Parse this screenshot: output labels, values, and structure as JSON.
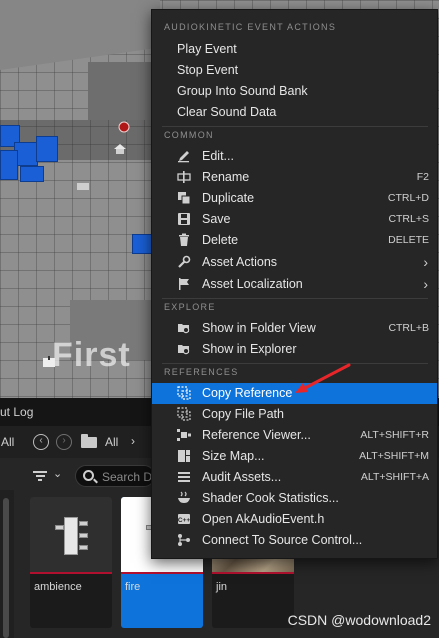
{
  "viewport": {
    "overlay_text": "First"
  },
  "content_browser": {
    "tab_label": "ut Log",
    "toolbar": {
      "all_label_1": "All",
      "back_icon": "arrow-left-circle-icon",
      "forward_icon": "arrow-right-circle-icon",
      "folder_icon": "folder-icon",
      "all_label_2": "All",
      "chevron": "›"
    },
    "filter": {
      "filter_icon": "filter-icon",
      "search_placeholder": "Search D"
    },
    "assets": [
      {
        "name": "ambience",
        "selected": false
      },
      {
        "name": "fire",
        "selected": true
      },
      {
        "name": "jin",
        "selected": false
      }
    ]
  },
  "context_menu": {
    "sections": {
      "audiokinetic": "AUDIOKINETIC EVENT ACTIONS",
      "common": "COMMON",
      "explore": "EXPLORE",
      "references": "REFERENCES"
    },
    "audiokinetic_items": [
      {
        "label": "Play Event"
      },
      {
        "label": "Stop Event"
      },
      {
        "label": "Group Into Sound Bank"
      },
      {
        "label": "Clear Sound Data"
      }
    ],
    "common_items": [
      {
        "label": "Edit...",
        "shortcut": "",
        "icon": "pencil-icon"
      },
      {
        "label": "Rename",
        "shortcut": "F2",
        "icon": "rename-icon"
      },
      {
        "label": "Duplicate",
        "shortcut": "CTRL+D",
        "icon": "duplicate-icon"
      },
      {
        "label": "Save",
        "shortcut": "CTRL+S",
        "icon": "save-icon"
      },
      {
        "label": "Delete",
        "shortcut": "DELETE",
        "icon": "trash-icon"
      },
      {
        "label": "Asset Actions",
        "shortcut": "",
        "icon": "wrench-icon",
        "submenu": true
      },
      {
        "label": "Asset Localization",
        "shortcut": "",
        "icon": "flag-icon",
        "submenu": true
      }
    ],
    "explore_items": [
      {
        "label": "Show in Folder View",
        "shortcut": "CTRL+B",
        "icon": "folder-search-icon"
      },
      {
        "label": "Show in Explorer",
        "shortcut": "",
        "icon": "folder-search-icon"
      }
    ],
    "reference_items": [
      {
        "label": "Copy Reference",
        "shortcut": "",
        "icon": "copy-reference-icon",
        "highlighted": true
      },
      {
        "label": "Copy File Path",
        "shortcut": "",
        "icon": "copy-path-icon"
      },
      {
        "label": "Reference Viewer...",
        "shortcut": "ALT+SHIFT+R",
        "icon": "reference-viewer-icon"
      },
      {
        "label": "Size Map...",
        "shortcut": "ALT+SHIFT+M",
        "icon": "size-map-icon"
      },
      {
        "label": "Audit Assets...",
        "shortcut": "ALT+SHIFT+A",
        "icon": "audit-icon"
      },
      {
        "label": "Shader Cook Statistics...",
        "shortcut": "",
        "icon": "shader-stats-icon"
      },
      {
        "label": "Open AkAudioEvent.h",
        "shortcut": "",
        "icon": "cpp-file-icon"
      },
      {
        "label": "Connect To Source Control...",
        "shortcut": "",
        "icon": "source-control-icon"
      }
    ]
  },
  "annotation": {
    "color": "#e8262a"
  },
  "watermark": "CSDN @wodownload2",
  "colors": {
    "menu_bg": "#262626",
    "highlight": "#0e74dc",
    "section_text": "#8f8f8f"
  }
}
